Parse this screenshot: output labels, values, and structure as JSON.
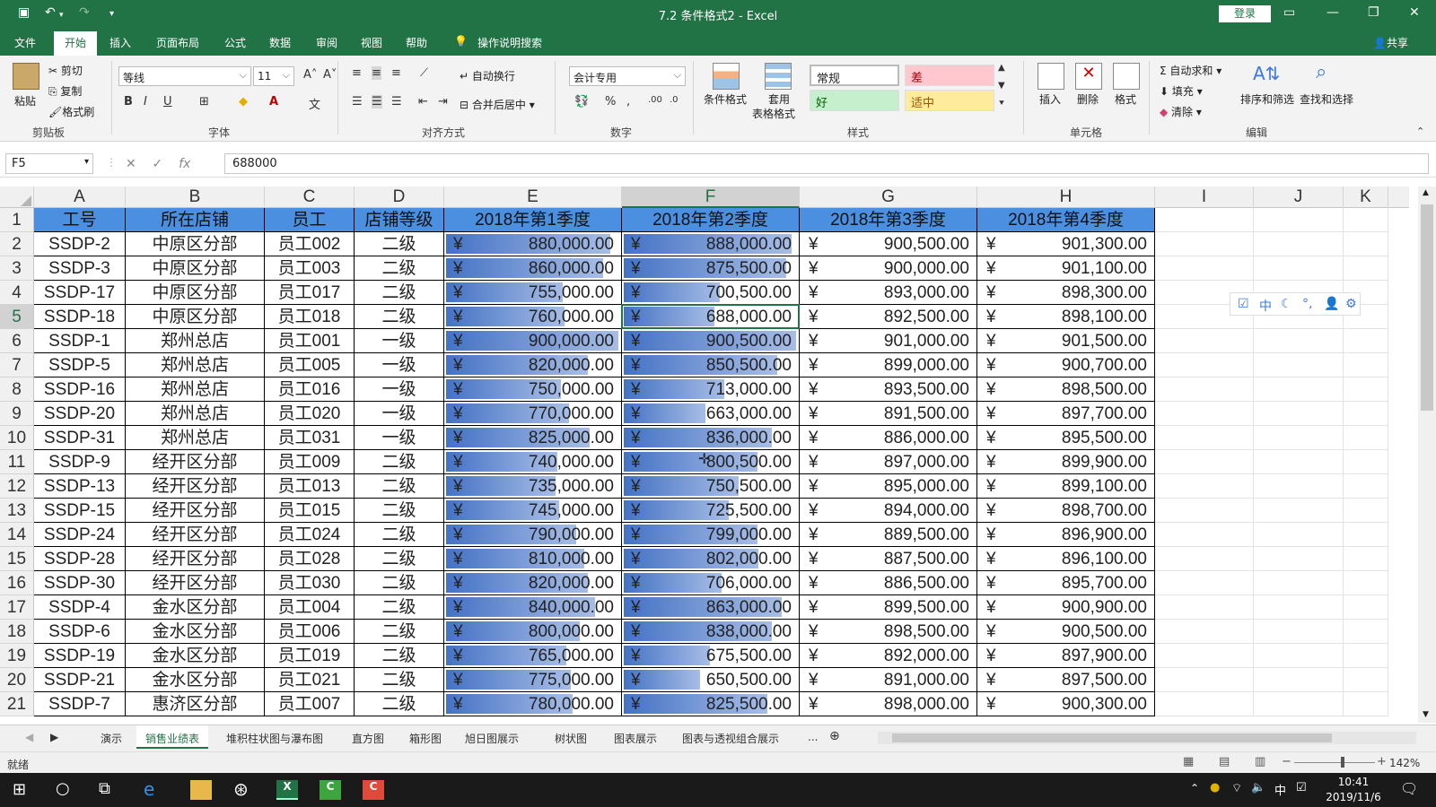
{
  "window": {
    "title": "7.2 条件格式2  -  Excel",
    "login": "登录"
  },
  "ribbon_tabs": [
    "文件",
    "开始",
    "插入",
    "页面布局",
    "公式",
    "数据",
    "审阅",
    "视图",
    "帮助"
  ],
  "tell_me": "操作说明搜索",
  "share": "共享",
  "clipboard": {
    "paste": "粘贴",
    "cut": "剪切",
    "copy": "复制",
    "format_painter": "格式刷",
    "group": "剪贴板"
  },
  "font": {
    "name": "等线",
    "size": "11",
    "group": "字体"
  },
  "alignment": {
    "wrap": "自动换行",
    "merge": "合并后居中",
    "group": "对齐方式"
  },
  "number": {
    "format": "会计专用",
    "group": "数字"
  },
  "styles": {
    "conditional": "条件格式",
    "table_line1": "套用",
    "table_line2": "表格格式",
    "normal": "常规",
    "bad": "差",
    "good": "好",
    "neutral": "适中",
    "group": "样式"
  },
  "cells": {
    "insert": "插入",
    "delete": "删除",
    "format": "格式",
    "group": "单元格"
  },
  "editing": {
    "autosum": "自动求和",
    "fill": "填充",
    "clear": "清除",
    "sort": "排序和筛选",
    "find": "查找和选择",
    "group": "编辑"
  },
  "formula_bar": {
    "name_box": "F5",
    "formula": "688000",
    "fx": "fx"
  },
  "columns": [
    "A",
    "B",
    "C",
    "D",
    "E",
    "F",
    "G",
    "H",
    "I",
    "J",
    "K"
  ],
  "headers": [
    "工号",
    "所在店铺",
    "员工",
    "店铺等级",
    "2018年第1季度",
    "2018年第2季度",
    "2018年第3季度",
    "2018年第4季度"
  ],
  "currency_symbol": "¥",
  "rows": [
    [
      "2",
      "SSDP-2",
      "中原区分部",
      "员工002",
      "二级",
      "880,000.00",
      "888,000.00",
      "900,500.00",
      "901,300.00"
    ],
    [
      "3",
      "SSDP-3",
      "中原区分部",
      "员工003",
      "二级",
      "860,000.00",
      "875,500.00",
      "900,000.00",
      "901,100.00"
    ],
    [
      "4",
      "SSDP-17",
      "中原区分部",
      "员工017",
      "二级",
      "755,000.00",
      "700,500.00",
      "893,000.00",
      "898,300.00"
    ],
    [
      "5",
      "SSDP-18",
      "中原区分部",
      "员工018",
      "二级",
      "760,000.00",
      "688,000.00",
      "892,500.00",
      "898,100.00"
    ],
    [
      "6",
      "SSDP-1",
      "郑州总店",
      "员工001",
      "一级",
      "900,000.00",
      "900,500.00",
      "901,000.00",
      "901,500.00"
    ],
    [
      "7",
      "SSDP-5",
      "郑州总店",
      "员工005",
      "一级",
      "820,000.00",
      "850,500.00",
      "899,000.00",
      "900,700.00"
    ],
    [
      "8",
      "SSDP-16",
      "郑州总店",
      "员工016",
      "一级",
      "750,000.00",
      "713,000.00",
      "893,500.00",
      "898,500.00"
    ],
    [
      "9",
      "SSDP-20",
      "郑州总店",
      "员工020",
      "一级",
      "770,000.00",
      "663,000.00",
      "891,500.00",
      "897,700.00"
    ],
    [
      "10",
      "SSDP-31",
      "郑州总店",
      "员工031",
      "一级",
      "825,000.00",
      "836,000.00",
      "886,000.00",
      "895,500.00"
    ],
    [
      "11",
      "SSDP-9",
      "经开区分部",
      "员工009",
      "二级",
      "740,000.00",
      "800,500.00",
      "897,000.00",
      "899,900.00"
    ],
    [
      "12",
      "SSDP-13",
      "经开区分部",
      "员工013",
      "二级",
      "735,000.00",
      "750,500.00",
      "895,000.00",
      "899,100.00"
    ],
    [
      "13",
      "SSDP-15",
      "经开区分部",
      "员工015",
      "二级",
      "745,000.00",
      "725,500.00",
      "894,000.00",
      "898,700.00"
    ],
    [
      "14",
      "SSDP-24",
      "经开区分部",
      "员工024",
      "二级",
      "790,000.00",
      "799,000.00",
      "889,500.00",
      "896,900.00"
    ],
    [
      "15",
      "SSDP-28",
      "经开区分部",
      "员工028",
      "二级",
      "810,000.00",
      "802,000.00",
      "887,500.00",
      "896,100.00"
    ],
    [
      "16",
      "SSDP-30",
      "经开区分部",
      "员工030",
      "二级",
      "820,000.00",
      "706,000.00",
      "886,500.00",
      "895,700.00"
    ],
    [
      "17",
      "SSDP-4",
      "金水区分部",
      "员工004",
      "二级",
      "840,000.00",
      "863,000.00",
      "899,500.00",
      "900,900.00"
    ],
    [
      "18",
      "SSDP-6",
      "金水区分部",
      "员工006",
      "二级",
      "800,000.00",
      "838,000.00",
      "898,500.00",
      "900,500.00"
    ],
    [
      "19",
      "SSDP-19",
      "金水区分部",
      "员工019",
      "二级",
      "765,000.00",
      "675,500.00",
      "892,000.00",
      "897,900.00"
    ],
    [
      "20",
      "SSDP-21",
      "金水区分部",
      "员工021",
      "二级",
      "775,000.00",
      "650,500.00",
      "891,000.00",
      "897,500.00"
    ],
    [
      "21",
      "SSDP-7",
      "惠济区分部",
      "员工007",
      "二级",
      "780,000.00",
      "825,500.00",
      "898,000.00",
      "900,300.00"
    ]
  ],
  "float_toolbar": [
    "中"
  ],
  "sheet_tabs": [
    "演示",
    "销售业绩表",
    "堆积柱状图与瀑布图",
    "直方图",
    "箱形图",
    "旭日图展示",
    "树状图",
    "图表展示",
    "图表与透视组合展示"
  ],
  "sheet_more": "...",
  "status": "就绪",
  "zoom": "142%",
  "taskbar": {
    "time": "10:41",
    "date": "2019/11/6",
    "ime": "中"
  },
  "colors": {
    "excel_green": "#217346",
    "header_fill": "#4a8fe0",
    "databar": "#4472c4"
  }
}
